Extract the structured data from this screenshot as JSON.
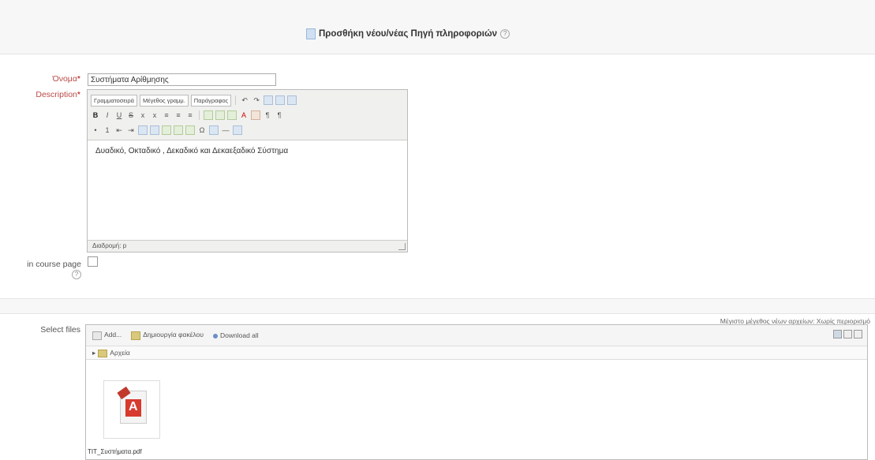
{
  "page": {
    "title": "Προσθήκη νέου/νέας Πηγή πληροφοριών",
    "help_symbol": "?"
  },
  "form": {
    "name_label": "Όνομα",
    "name_value": "Συστήματα Αρίθμησης",
    "description_label": "Description",
    "required_mark": "*",
    "show_label": "in course page",
    "help_symbol": "?",
    "files_label": "Select files"
  },
  "editor": {
    "font_family_select": "Γραμματοσειρά",
    "font_size_select": "Μέγεθος γραμμ.",
    "paragraph_select": "Παράγραφος",
    "content": "Δυαδικό, Οκταδικό , Δεκαδικό και Δεκαεξαδικό Σύστημα",
    "status_path": "Διαδρομή: p"
  },
  "file_picker": {
    "limit_text": "Μέγιστο μέγεθος νέων αρχείων: Χωρίς περιορισμό",
    "add_label": "Add...",
    "create_folder_label": "Δημιουργία φακέλου",
    "download_label": "Download all",
    "path_label": "Αρχεία",
    "file_name": "TIT_Συστήματα.pdf"
  },
  "colors": {
    "band_bg": "#f7f7f7",
    "required": "#b00000",
    "pdf_red": "#d73a2e"
  }
}
